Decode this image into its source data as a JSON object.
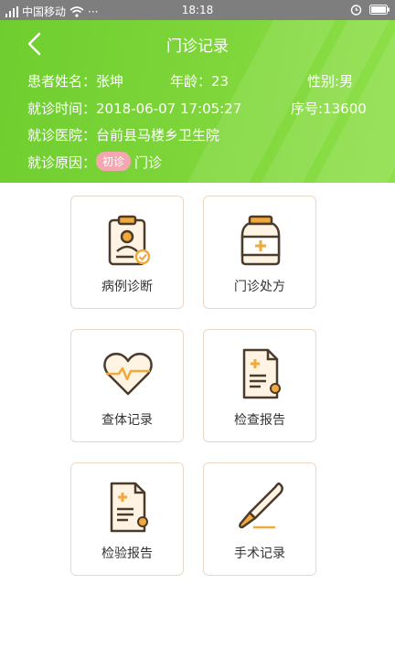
{
  "status_bar": {
    "carrier": "中国移动",
    "time": "18:18",
    "dots": "···"
  },
  "header": {
    "title": "门诊记录",
    "patient_name_label": "患者姓名：",
    "patient_name": "张坤",
    "age_label": "年龄：",
    "age": "23",
    "gender_label": "性别:",
    "gender": "男",
    "visit_time_label": "就诊时间：",
    "visit_time": "2018-06-07 17:05:27",
    "serial_label": "序号:",
    "serial": "13600",
    "hospital_label": "就诊医院：",
    "hospital": "台前县马楼乡卫生院",
    "reason_label": "就诊原因：",
    "reason_badge": "初诊",
    "reason": "门诊"
  },
  "menu": [
    {
      "label": "病例诊断",
      "icon": "clipboard-icon"
    },
    {
      "label": "门诊处方",
      "icon": "medicine-bottle-icon"
    },
    {
      "label": "查体记录",
      "icon": "heart-pulse-icon"
    },
    {
      "label": "检查报告",
      "icon": "report-document-icon"
    },
    {
      "label": "检验报告",
      "icon": "lab-report-icon"
    },
    {
      "label": "手术记录",
      "icon": "scalpel-icon"
    }
  ],
  "colors": {
    "header_green": "#7ed43a",
    "accent_orange": "#f2a93b",
    "icon_outline": "#4a3b2c",
    "badge_pink": "#f4a7b0"
  }
}
